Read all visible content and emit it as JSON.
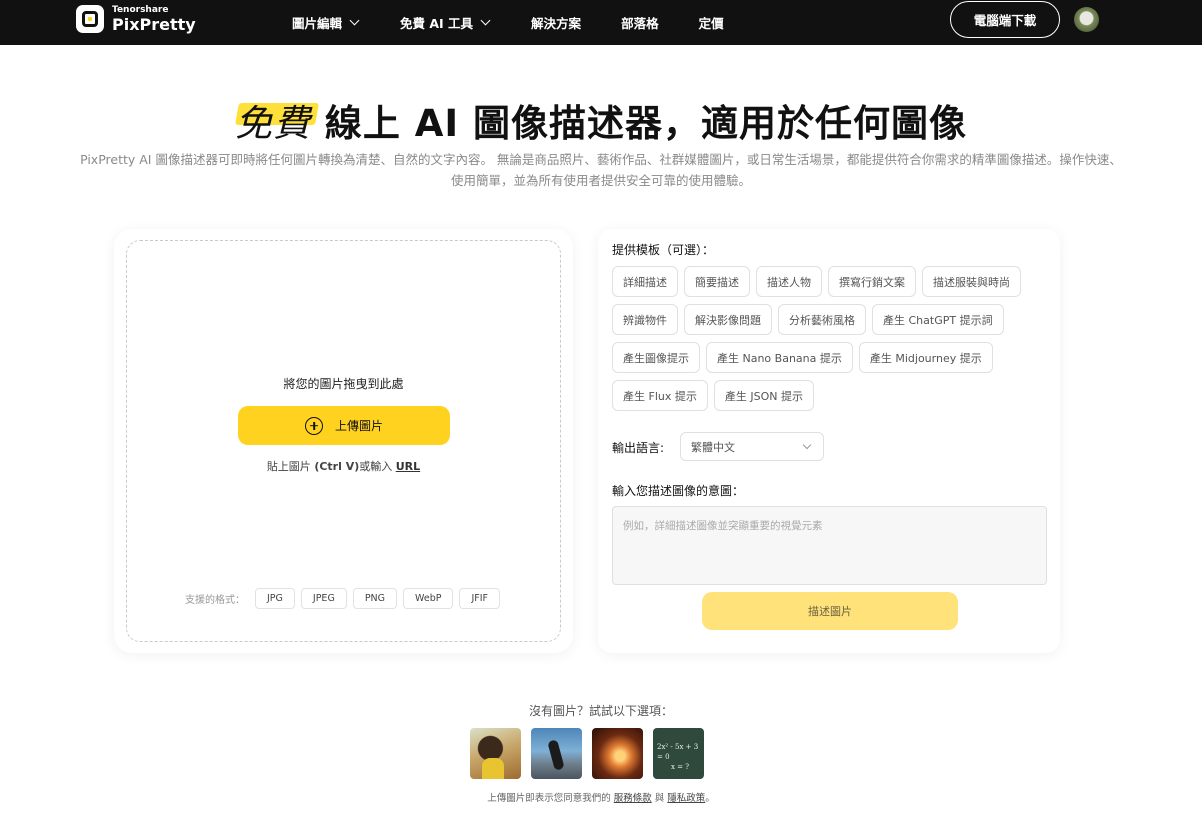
{
  "header": {
    "brand_small": "Tenorshare",
    "brand_name": "PixPretty",
    "nav": [
      {
        "label": "圖片編輯",
        "dropdown": true
      },
      {
        "label": "免費 AI 工具",
        "dropdown": true
      },
      {
        "label": "解決方案",
        "dropdown": false
      },
      {
        "label": "部落格",
        "dropdown": false
      },
      {
        "label": "定價",
        "dropdown": false
      }
    ],
    "download_label": "電腦端下載"
  },
  "hero": {
    "title_highlight": "免費",
    "title_rest": " 線上 AI 圖像描述器，適用於任何圖像",
    "description": "PixPretty AI 圖像描述器可即時將任何圖片轉換為清楚、自然的文字內容。 無論是商品照片、藝術作品、社群媒體圖片，或日常生活場景，都能提供符合你需求的精準圖像描述。操作快速、使用簡單，並為所有使用者提供安全可靠的使用體驗。"
  },
  "upload": {
    "drop_text": "將您的圖片拖曳到此處",
    "button_label": "上傳圖片",
    "paste_prefix": "貼上圖片 ",
    "paste_shortcut": "(Ctrl V)",
    "paste_middle": "或輸入 ",
    "paste_url": "URL",
    "formats_label": "支援的格式：",
    "formats": [
      "JPG",
      "JPEG",
      "PNG",
      "WebP",
      "JFIF"
    ]
  },
  "panel": {
    "template_label": "提供模板（可選）：",
    "chip_rows": [
      [
        "詳細描述",
        "簡要描述",
        "描述人物",
        "撰寫行銷文案",
        "描述服裝與時尚"
      ],
      [
        "辨識物件",
        "解決影像問題",
        "分析藝術風格",
        "產生 ChatGPT 提示詞"
      ],
      [
        "產生圖像提示",
        "產生 Nano Banana 提示",
        "產生 Midjourney 提示"
      ],
      [
        "產生 Flux 提示",
        "產生 JSON 提示"
      ]
    ],
    "language_label": "輸出語言:",
    "language_value": "繁體中文",
    "intent_label": "輸入您描述圖像的意圖：",
    "intent_placeholder": "例如，詳細描述圖像並突顯重要的視覺元素",
    "describe_label": "描述圖片"
  },
  "samples": {
    "title": "沒有圖片？試試以下選項：",
    "thumb4_eq1": "2x² - 5x + 3 = 0",
    "thumb4_eq2": "x = ?",
    "terms_prefix": "上傳圖片即表示您同意我們的 ",
    "terms_link": "服務條款",
    "terms_middle": " 與 ",
    "privacy_link": "隱私政策",
    "terms_suffix": "。"
  },
  "colors": {
    "accent": "#FFD21F",
    "topbar": "#111111",
    "disabled_button": "#FFE27A"
  }
}
